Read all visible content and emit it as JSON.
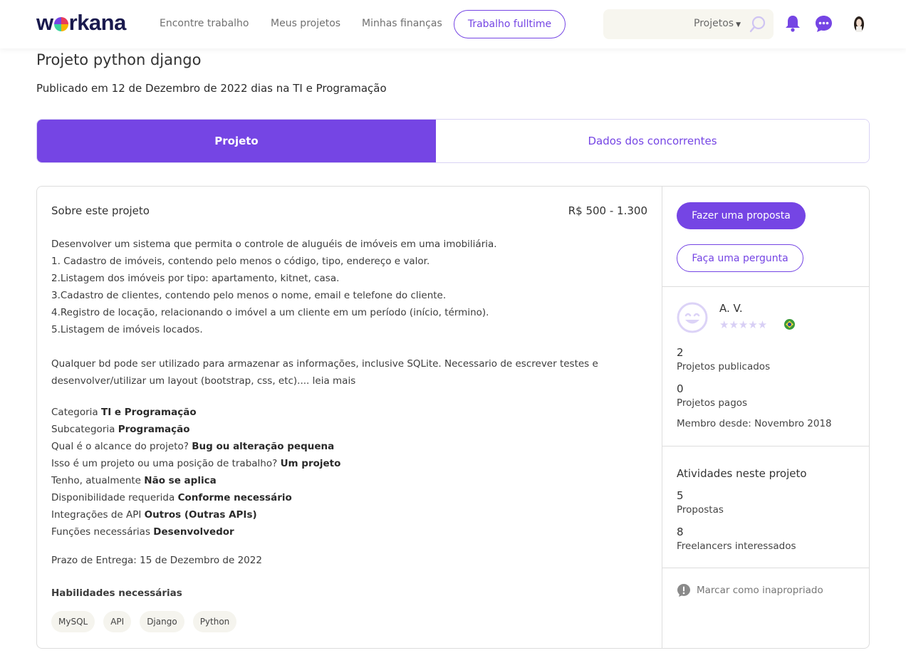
{
  "header": {
    "logo": {
      "before": "w",
      "after": "rkana"
    },
    "nav": [
      "Encontre trabalho",
      "Meus projetos",
      "Minhas finanças"
    ],
    "fulltime_label": "Trabalho fulltime",
    "search": {
      "category": "Projetos",
      "value": ""
    }
  },
  "project": {
    "title": "Projeto python django",
    "subtitle": "Publicado em 12 de Dezembro de 2022 dias na TI e Programação",
    "tabs": [
      "Projeto",
      "Dados dos concorrentes"
    ],
    "about_title": "Sobre este projeto",
    "budget": "R$ 500 - 1.300",
    "description_lines": [
      "Desenvolver um sistema que permita o controle de aluguéis de imóveis em uma imobiliária.",
      "1. Cadastro de imóveis, contendo pelo menos o código, tipo, endereço e valor.",
      "2.Listagem dos imóveis por tipo: apartamento, kitnet, casa.",
      "3.Cadastro de clientes, contendo pelo menos o nome, email e telefone do cliente.",
      "4.Registro de locação, relacionando o imóvel a um cliente em um período (início, término).",
      "5.Listagem de imóveis locados."
    ],
    "description_para2": "Qualquer bd pode ser utilizado para armazenar as informações, inclusive SQLite. Necessario de escrever testes e desenvolver/utilizar um layout (bootstrap, css, etc)....",
    "read_more": "leia mais",
    "facts": [
      {
        "label": "Categoria",
        "value": "TI e Programação"
      },
      {
        "label": "Subcategoria",
        "value": "Programação"
      },
      {
        "label": "Qual é o alcance do projeto?",
        "value": "Bug ou alteração pequena"
      },
      {
        "label": "Isso é um projeto ou uma posição de trabalho?",
        "value": "Um projeto"
      },
      {
        "label": "Tenho, atualmente",
        "value": "Não se aplica"
      },
      {
        "label": "Disponibilidade requerida",
        "value": "Conforme necessário"
      },
      {
        "label": "Integrações de API",
        "value": "Outros (Outras APIs)"
      },
      {
        "label": "Funções necessárias",
        "value": "Desenvolvedor"
      }
    ],
    "deadline": "Prazo de Entrega: 15 de Dezembro de 2022",
    "skills_title": "Habilidades necessárias",
    "skills": [
      "MySQL",
      "API",
      "Django",
      "Python"
    ]
  },
  "sidebar": {
    "propose_label": "Fazer uma proposta",
    "question_label": "Faça uma pergunta",
    "client": {
      "name": "A. V.",
      "rating": 0,
      "stars": "★★★★★",
      "published_count": "2",
      "published_label": "Projetos publicados",
      "paid_count": "0",
      "paid_label": "Projetos pagos",
      "member_since": "Membro desde: Novembro 2018"
    },
    "activities": {
      "title": "Atividades neste projeto",
      "proposals_count": "5",
      "proposals_label": "Propostas",
      "interested_count": "8",
      "interested_label": "Freelancers interessados"
    },
    "report_label": "Marcar como inapropriado"
  },
  "colors": {
    "accent": "#7545e4",
    "star_empty": "#d8cff5",
    "flag_green": "#3a9b3a"
  },
  "icons": [
    "search-icon",
    "bell-icon",
    "chat-icon",
    "avatar",
    "chevron-down-icon",
    "client-avatar-icon",
    "flag-icon",
    "alert-icon"
  ]
}
